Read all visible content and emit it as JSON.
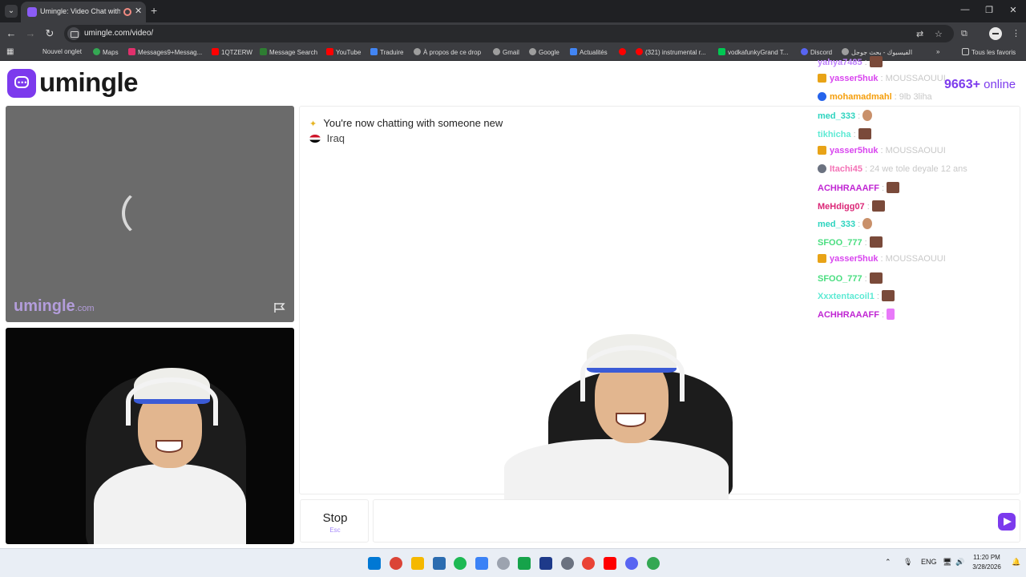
{
  "browser": {
    "tab_title": "Umingle: Video Chat with S",
    "url": "umingle.com/video/"
  },
  "bookmarks": [
    {
      "label": "Nouvel onglet",
      "color": "#3c3d41"
    },
    {
      "label": "Maps",
      "color": "#34a853"
    },
    {
      "label": "Messages9+Messag...",
      "color": "#e1306c"
    },
    {
      "label": "1QTZERW",
      "color": "#ff0000"
    },
    {
      "label": "Message Search",
      "color": "#2e7d32"
    },
    {
      "label": "YouTube",
      "color": "#ff0000"
    },
    {
      "label": "Traduire",
      "color": "#4285f4"
    },
    {
      "label": "À propos de ce drop",
      "color": "#9e9e9e"
    },
    {
      "label": "Gmail",
      "color": "#9e9e9e"
    },
    {
      "label": "Google",
      "color": "#9e9e9e"
    },
    {
      "label": "Actualités",
      "color": "#4285f4"
    },
    {
      "label": "",
      "color": "#ff0000"
    },
    {
      "label": "(321) instrumental r...",
      "color": "#ff0000"
    },
    {
      "label": "vodkafunkyGrand T...",
      "color": "#00c853"
    },
    {
      "label": "Discord",
      "color": "#5865f2"
    },
    {
      "label": "الفيسبوك - بحث جوجل",
      "color": "#9e9e9e"
    }
  ],
  "bookmarks_all": "Tous les favoris",
  "site": {
    "logo_text": "umingle",
    "online_count": "9663+",
    "online_label": "online",
    "watermark": "umingle",
    "watermark_suffix": ".com"
  },
  "chat": {
    "system_message": "You're now chatting with someone new",
    "country": "Iraq"
  },
  "feed": [
    {
      "name": "yahya7485",
      "color": "#c084fc",
      "badge": "",
      "message": "",
      "image": true
    },
    {
      "name": "yasser5huk",
      "color": "#d946ef",
      "badge": "#e8a317",
      "message": "MOUSSAOUUI",
      "image": false
    },
    {
      "name": "mohamadmahl",
      "color": "#f59e0b",
      "badge": "#2563eb",
      "message": "9lb 3liha",
      "image": false
    },
    {
      "name": "med_333",
      "color": "#2dd4bf",
      "badge": "",
      "message": "",
      "image": true
    },
    {
      "name": "tikhicha",
      "color": "#5eead4",
      "badge": "",
      "message": "",
      "image": true
    },
    {
      "name": "yasser5huk",
      "color": "#d946ef",
      "badge": "#e8a317",
      "message": "MOUSSAOUUI",
      "image": false
    },
    {
      "name": "Itachi45",
      "color": "#f472b6",
      "badge": "#6b7280",
      "message": "24 we tole deyale 12 ans",
      "image": false
    },
    {
      "name": "ACHHRAAAFF",
      "color": "#c026d3",
      "badge": "",
      "message": "",
      "image": true
    },
    {
      "name": "MeHdigg07",
      "color": "#db2777",
      "badge": "",
      "message": "",
      "image": true
    },
    {
      "name": "med_333",
      "color": "#2dd4bf",
      "badge": "",
      "message": "",
      "image": true
    },
    {
      "name": "SFOO_777",
      "color": "#4ade80",
      "badge": "",
      "message": "",
      "image": true
    },
    {
      "name": "yasser5huk",
      "color": "#d946ef",
      "badge": "#e8a317",
      "message": "MOUSSAOUUI",
      "image": false
    },
    {
      "name": "SFOO_777",
      "color": "#4ade80",
      "badge": "",
      "message": "",
      "image": true
    },
    {
      "name": "Xxxtentacoil1",
      "color": "#5eead4",
      "badge": "",
      "message": "",
      "image": true
    },
    {
      "name": "ACHHRAAAFF",
      "color": "#c026d3",
      "badge": "",
      "message": "",
      "image": true
    }
  ],
  "controls": {
    "stop_label": "Stop",
    "stop_hint": "Esc",
    "message_placeholder": ""
  },
  "taskbar": {
    "language": "ENG",
    "time": "11:20 PM",
    "date": "3/28/2026"
  }
}
